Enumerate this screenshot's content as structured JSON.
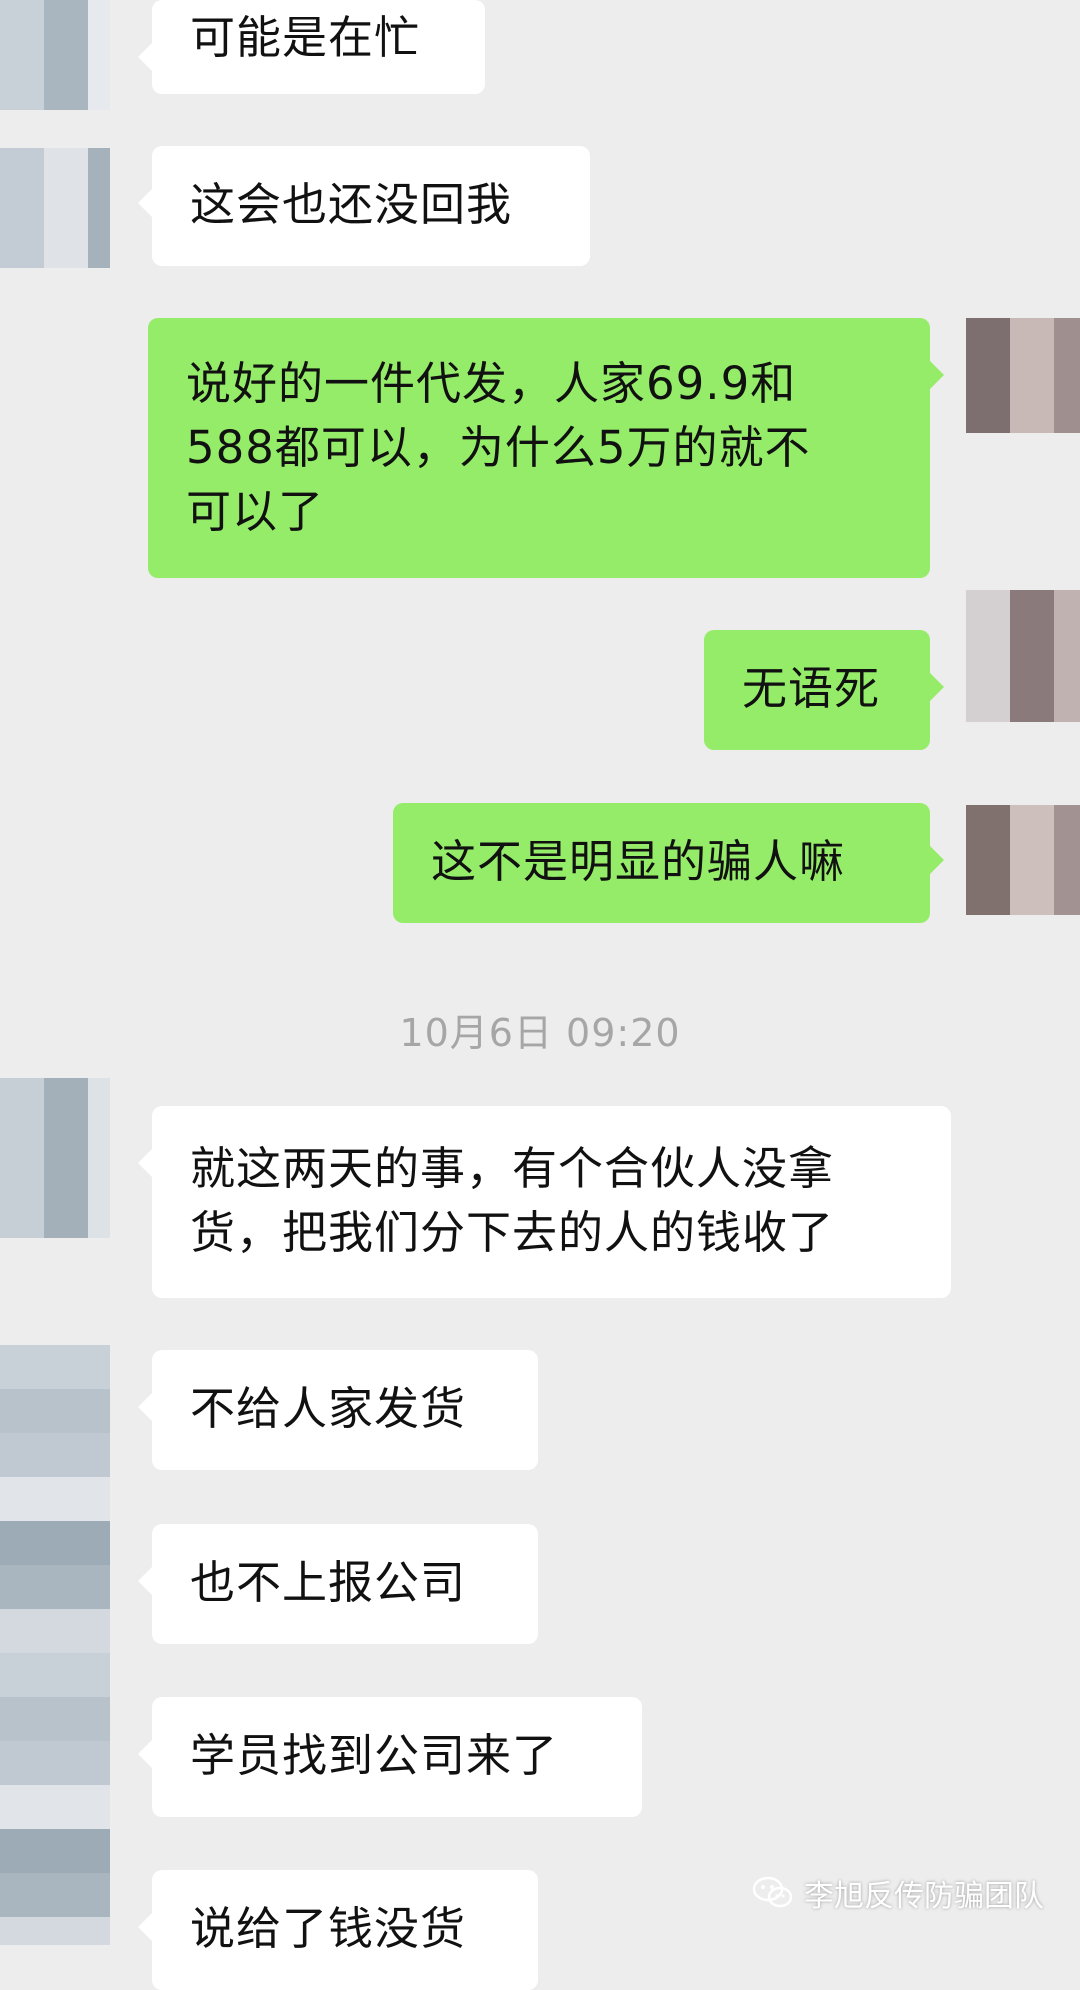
{
  "messages": [
    {
      "side": "in",
      "text": "可能是在忙"
    },
    {
      "side": "in",
      "text": "这会也还没回我"
    },
    {
      "side": "out",
      "text": "说好的一件代发，人家69.9和\n588都可以，为什么5万的就不\n可以了"
    },
    {
      "side": "out",
      "text": "无语死"
    },
    {
      "side": "out",
      "text": "这不是明显的骗人嘛"
    },
    {
      "side": "in",
      "text": "就这两天的事，有个合伙人没拿\n货，把我们分下去的人的钱收了"
    },
    {
      "side": "in",
      "text": "不给人家发货"
    },
    {
      "side": "in",
      "text": "也不上报公司"
    },
    {
      "side": "in",
      "text": "学员找到公司来了"
    },
    {
      "side": "in",
      "text": "说给了钱没货"
    }
  ],
  "timestamp": "10月6日 09:20",
  "watermark": {
    "text": "李旭反传防骗团队",
    "icon": "wechat-icon"
  },
  "colors": {
    "background": "#ededed",
    "incoming_bubble": "#ffffff",
    "outgoing_bubble": "#95ec69"
  }
}
